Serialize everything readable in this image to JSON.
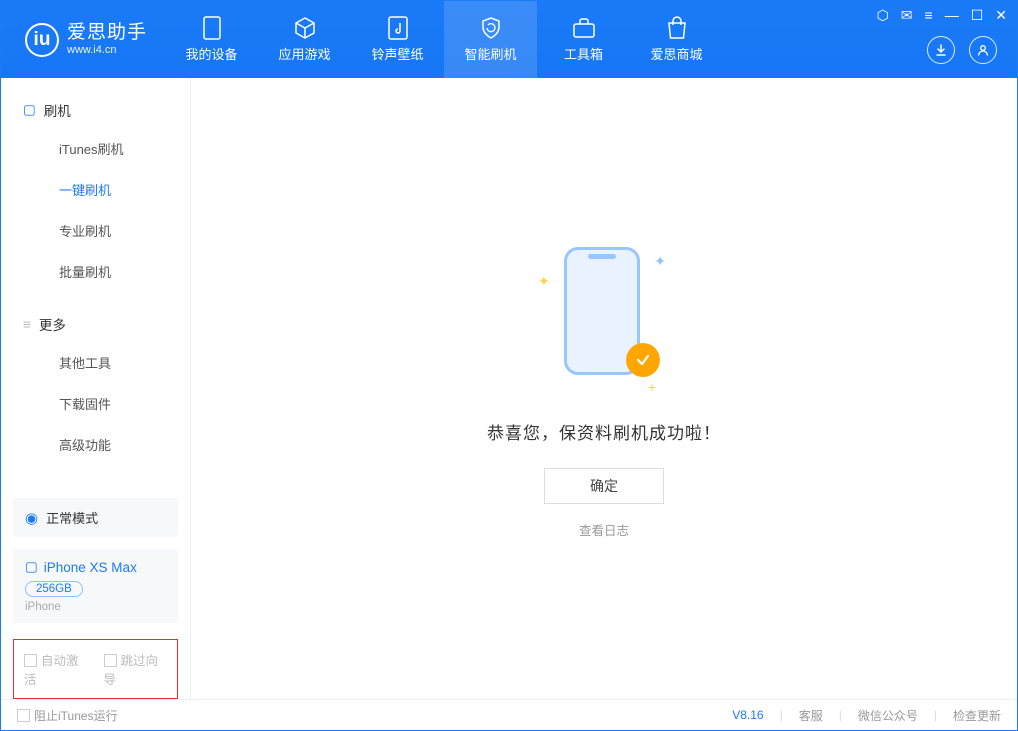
{
  "brand": {
    "name": "爱思助手",
    "url": "www.i4.cn"
  },
  "nav": {
    "device": "我的设备",
    "apps": "应用游戏",
    "ring": "铃声壁纸",
    "flash": "智能刷机",
    "toolbox": "工具箱",
    "store": "爱思商城"
  },
  "sidebar": {
    "group1_title": "刷机",
    "itunes": "iTunes刷机",
    "onekey": "一键刷机",
    "pro": "专业刷机",
    "batch": "批量刷机",
    "group2_title": "更多",
    "other": "其他工具",
    "firmware": "下载固件",
    "advanced": "高级功能"
  },
  "mode_label": "正常模式",
  "device": {
    "name": "iPhone XS Max",
    "capacity": "256GB",
    "type": "iPhone"
  },
  "opts": {
    "auto_activate": "自动激活",
    "skip_guide": "跳过向导"
  },
  "main": {
    "success": "恭喜您，保资料刷机成功啦！",
    "ok": "确定",
    "view_log": "查看日志"
  },
  "status": {
    "block_itunes": "阻止iTunes运行",
    "version": "V8.16",
    "support": "客服",
    "wechat": "微信公众号",
    "update": "检查更新"
  }
}
